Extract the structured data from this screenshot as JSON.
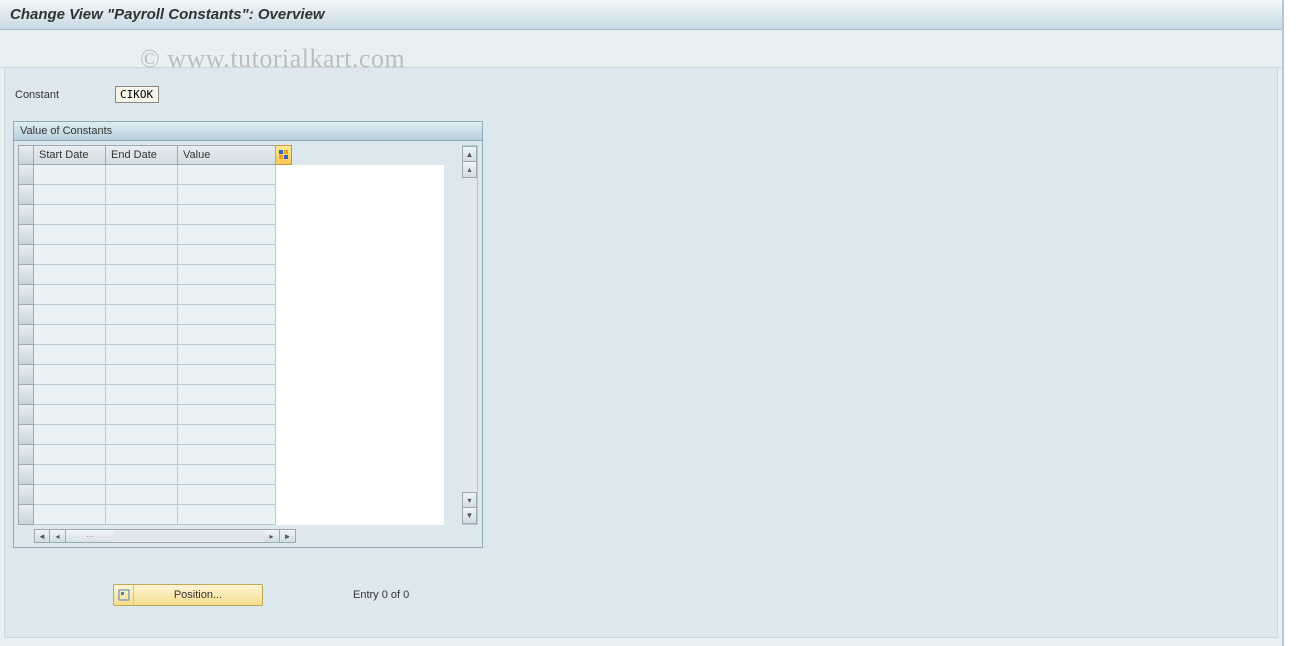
{
  "title": "Change View \"Payroll Constants\": Overview",
  "watermark": "© www.tutorialkart.com",
  "constant": {
    "label": "Constant",
    "value": "CIKOK"
  },
  "panel": {
    "title": "Value of Constants",
    "columns": {
      "start_date": "Start Date",
      "end_date": "End Date",
      "value": "Value"
    },
    "row_count": 18
  },
  "footer": {
    "position_button": "Position...",
    "entry_text": "Entry 0 of 0"
  }
}
